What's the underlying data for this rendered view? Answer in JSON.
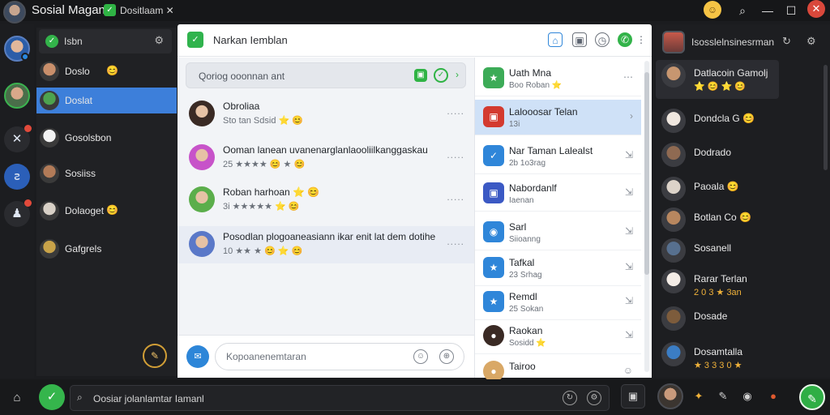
{
  "titlebar": {
    "title": "Sosial Magani",
    "subtitle": "Dositlaam ✕",
    "icons": [
      "avatar",
      "app-badge",
      "emoji-face-icon",
      "search-icon",
      "minimize-icon",
      "maximize-icon",
      "close-icon"
    ]
  },
  "contacts": {
    "search_label": "Isbn",
    "items": [
      {
        "label": "Doslo",
        "emoji": "😊",
        "avatar_color": "#c98f6b"
      },
      {
        "label": "Doslat",
        "emoji": "",
        "avatar_color": "#4da34f"
      },
      {
        "label": "Gosolsbon",
        "emoji": "",
        "avatar_color": "#f2f2f2"
      },
      {
        "label": "Sosiiss",
        "emoji": "",
        "avatar_color": "#b27b58"
      },
      {
        "label": "Dolaoget",
        "emoji": "😊",
        "avatar_color": "#d8d0c6"
      },
      {
        "label": "Gafgrels",
        "emoji": "",
        "avatar_color": "#c9a349"
      }
    ],
    "active_index": 1
  },
  "main": {
    "title": "Narkan Iemblan",
    "search_placeholder": "Qoriog ooonnan ant",
    "messages": [
      {
        "name": "Obroliaa",
        "sub": "Sto tan Sdsid ⭐ 😊",
        "avatar_color": "#3a2a24",
        "more": "....."
      },
      {
        "name": "Ooman lanean uvanenarglanlaooliilkanggaskau",
        "sub": "25 ★★★★ 😊 ★ 😊",
        "avatar_color": "#c753c9",
        "more": "....."
      },
      {
        "name": "Roban harhoan ⭐ 😊",
        "sub": "3i ★★★★★ ⭐ 😊",
        "avatar_color": "#5bae4b",
        "more": "....."
      },
      {
        "name": "Posodlan plogoaneasiann ikar enit lat dem dotihe",
        "sub": "10 ★★ ★ 😊 ⭐ 😊",
        "avatar_color": "#5a78c8",
        "more": "....."
      }
    ],
    "composer_placeholder": "Kopoanenemtaran"
  },
  "sidelist": {
    "items": [
      {
        "name": "Uath Mna",
        "sub": "Boo Roban ⭐",
        "icon_color": "#3cab57"
      },
      {
        "name": "Lalooosar Telan",
        "sub": "13i",
        "icon_color": "#d33a2f"
      },
      {
        "name": "Nar Taman Lalealst",
        "sub": "2b 1o3rag",
        "icon_color": "#2f86d9"
      },
      {
        "name": "Nabordanlf",
        "sub": "Iaenan",
        "icon_color": "#3b59c4"
      },
      {
        "name": "Sarl",
        "sub": "Siioanng",
        "icon_color": "#2f86d9"
      },
      {
        "name": "Tafkal",
        "sub": "23 Srhag",
        "icon_color": "#2f86d9"
      },
      {
        "name": "Remdl",
        "sub": "25 Sokan",
        "icon_color": "#2f86d9"
      },
      {
        "name": "Raokan",
        "sub": "Sosidd ⭐",
        "icon_color": "#3a2a24"
      },
      {
        "name": "Tairoo",
        "sub": "",
        "icon_color": "#d9a866"
      }
    ],
    "selected_index": 1
  },
  "right_panel": {
    "header_label": "Isosslelnsinesrman",
    "items": [
      {
        "name": "Datlacoin Gamolj",
        "sub": "⭐ 😊 ⭐ 😊",
        "avatar_color": "#c79670"
      },
      {
        "name": "Dondcla G 😊",
        "sub": "",
        "avatar_color": "#f0e8e0"
      },
      {
        "name": "Dodrado",
        "sub": "",
        "avatar_color": "#8f6a52"
      },
      {
        "name": "Paoala 😊",
        "sub": "",
        "avatar_color": "#dcd3c9"
      },
      {
        "name": "Botlan Co 😊",
        "sub": "",
        "avatar_color": "#b8875f"
      },
      {
        "name": "Sosanell",
        "sub": "",
        "avatar_color": "#57708f"
      },
      {
        "name": "Rarar Terlan",
        "sub": "2 0 3 ★ 3an",
        "avatar_color": "#f3ece6"
      },
      {
        "name": "Dosade",
        "sub": "",
        "avatar_color": "#7d5c3c"
      },
      {
        "name": "Dosamtalla",
        "sub": "★ 3 3 3 0 ★",
        "avatar_color": "#3b7dc4"
      }
    ]
  },
  "bottombar": {
    "search_placeholder": "Oosiar jolanlamtar Iamanl",
    "buttons": [
      "home-icon",
      "app-launcher",
      "refresh-icon",
      "settings-icon",
      "square-icon",
      "avatar",
      "sparkle-icon",
      "pen-icon",
      "record-icon",
      "status-icon",
      "compose-icon"
    ]
  },
  "colors": {
    "accent_green": "#35b54c",
    "selection_blue": "#3d7fda",
    "side_selection": "#cfe1f7"
  }
}
